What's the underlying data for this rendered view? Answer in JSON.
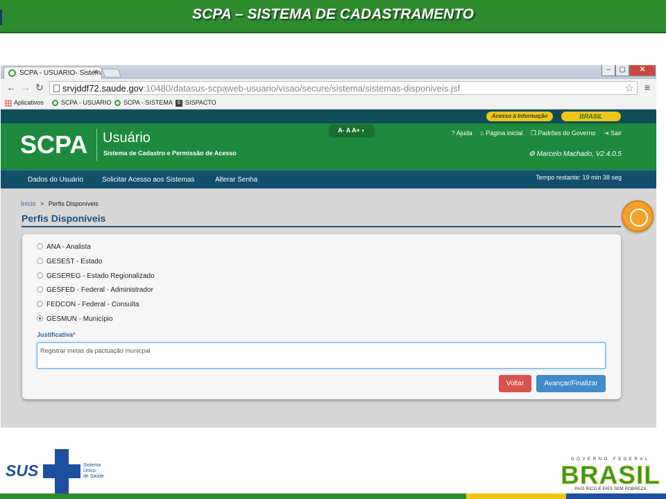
{
  "slide": {
    "title": "SCPA – SISTEMA DE CADASTRAMENTO"
  },
  "browser": {
    "tab_title": "SCPA - USUARIO- Sistema",
    "tab_close": "✕",
    "window_controls": {
      "minimize": "–",
      "maximize": "▢",
      "close": "✕"
    },
    "url_host": "srvjddf72.saude.gov",
    "url_path": ":10480/datasus-scpaweb-usuario/visao/secure/sistema/sistemas-disponiveis.jsf",
    "bookmarks": [
      {
        "label": "Aplicativos",
        "icon": "apps-icon"
      },
      {
        "label": "SCPA - USUARIO",
        "icon": "scpa-favicon"
      },
      {
        "label": "SCPA - SISTEMA",
        "icon": "scpa-favicon"
      },
      {
        "label": "SISPACTO",
        "icon": "sispacto-icon"
      }
    ]
  },
  "gov_bar": {
    "access": "Acesso à Informação",
    "brasil": "BRASIL"
  },
  "app": {
    "brand": "SCPA",
    "name": "Usuário",
    "subtitle": "Sistema de Cadastro e Permissão de Acesso",
    "font_controls": "A-  A  A+ ◐",
    "links": {
      "help": "? Ajuda",
      "home": "⌂ Página inicial",
      "standards": "❐ Padrões do Governo",
      "logout": "⇥ Sair"
    },
    "user": "⚙ Marcelo Machado, V2.4.0.5",
    "nav": [
      "Dados do Usuário",
      "Solicitar Acesso aos Sistemas",
      "Alterar Senha"
    ],
    "timer": "Tempo restante: 19 min 38 seg"
  },
  "page": {
    "breadcrumb_home": "Início",
    "breadcrumb_sep": ">",
    "breadcrumb_current": "Perfis Disponíveis",
    "title": "Perfis Disponíveis",
    "profiles": [
      {
        "label": "ANA - Analista",
        "selected": false
      },
      {
        "label": "GESEST - Estado",
        "selected": false
      },
      {
        "label": "GESEREG - Estado Regionalizado",
        "selected": false
      },
      {
        "label": "GESFED - Federal - Administrador",
        "selected": false
      },
      {
        "label": "FEDCON - Federal - Consulta",
        "selected": false
      },
      {
        "label": "GESMUN - Município",
        "selected": true
      }
    ],
    "justificativa_label": "Justificativa",
    "required_mark": "*",
    "justificativa_value": "Registrar metas da pactuação municpal",
    "back_button": "Voltar",
    "next_button": "Avançar/Finalizar"
  },
  "footer": {
    "sus_logo": "SUS",
    "sus_sub": [
      "Sistema",
      "Único",
      "de Saúde"
    ],
    "gov_top": "GOVERNO FEDERAL",
    "gov_word": "BRASIL",
    "gov_bottom": "PAÍS RICO É PAÍS SEM POBREZA"
  }
}
